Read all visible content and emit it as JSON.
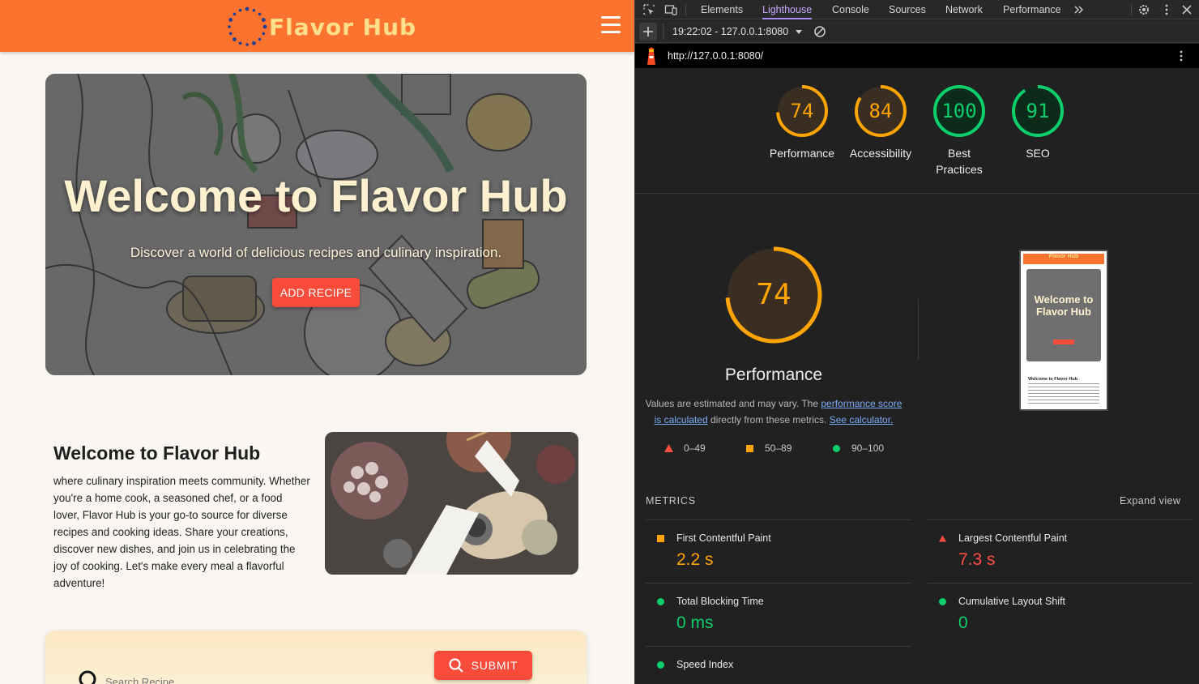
{
  "site": {
    "logo_text": "Flavor Hub",
    "hero": {
      "title": "Welcome to Flavor Hub",
      "subtitle": "Discover a world of delicious recipes and culinary inspiration.",
      "button": "ADD RECIPE"
    },
    "welcome": {
      "title": "Welcome to Flavor Hub",
      "text": "where culinary inspiration meets community. Whether you're a home cook, a seasoned chef, or a food lover, Flavor Hub is your go-to source for diverse recipes and cooking ideas. Share your creations, discover new dishes, and join us in celebrating the joy of cooking. Let's make every meal a flavorful adventure!"
    },
    "search": {
      "placeholder": "Search Recipe",
      "submit": "SUBMIT"
    },
    "colors": {
      "header": "#fc7330",
      "button": "#f94b3a",
      "logo": "#ffe08a"
    }
  },
  "devtools": {
    "tabs": [
      "Elements",
      "Lighthouse",
      "Console",
      "Sources",
      "Network",
      "Performance"
    ],
    "active_tab": "Lighthouse",
    "report_selector": "19:22:02 - 127.0.0.1:8080",
    "url": "http://127.0.0.1:8080/",
    "scores": [
      {
        "value": 74,
        "label": "Performance",
        "color": "#ffa400"
      },
      {
        "value": 84,
        "label": "Accessibility",
        "color": "#ffa400"
      },
      {
        "value": 100,
        "label": "Best Practices",
        "color": "#0cce6b"
      },
      {
        "value": 91,
        "label": "SEO",
        "color": "#0cce6b"
      }
    ],
    "performance": {
      "score": 74,
      "title": "Performance",
      "desc_pre": "Values are estimated and may vary. The ",
      "desc_link1": "performance score is calculated",
      "desc_mid": " directly from these metrics. ",
      "desc_link2": "See calculator."
    },
    "legend": [
      "0–49",
      "50–89",
      "90–100"
    ],
    "metrics_header": "METRICS",
    "expand_view": "Expand view",
    "metrics": [
      {
        "name": "First Contentful Paint",
        "value": "2.2 s",
        "status": "average"
      },
      {
        "name": "Largest Contentful Paint",
        "value": "7.3 s",
        "status": "fail"
      },
      {
        "name": "Total Blocking Time",
        "value": "0 ms",
        "status": "pass"
      },
      {
        "name": "Cumulative Layout Shift",
        "value": "0",
        "status": "pass"
      },
      {
        "name": "Speed Index",
        "value": "",
        "status": "pass"
      }
    ],
    "thumb": {
      "logo": "Flavor Hub",
      "hero_title": "Welcome to Flavor Hub",
      "welcome_title": "Welcome to Flavor Hub"
    }
  }
}
